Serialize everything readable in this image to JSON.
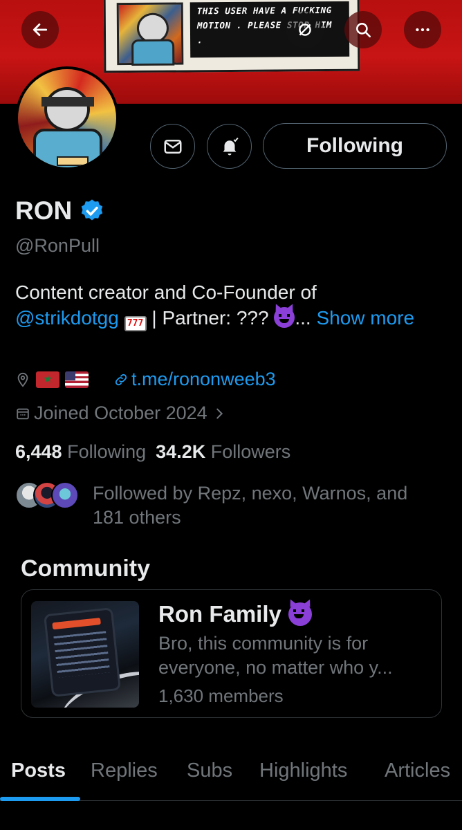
{
  "header": {
    "banner_text": "THIS USER HAVE A FUCKING MOTION . PLEASE STOP HIM .",
    "back_icon": "back-arrow-icon",
    "search_icon": "search-icon",
    "more_icon": "more-icon"
  },
  "profile": {
    "display_name": "RON",
    "handle": "@RonPull",
    "following_label": "Following",
    "bio_text": "Content creator and Co-Founder of",
    "bio_mention": "@strikdotgg",
    "bio_partner": "| Partner: ???",
    "bio_ellipsis": "...",
    "show_more": "Show more",
    "website": "t.me/rononweeb3",
    "joined": "Joined October 2024",
    "following_count": "6,448",
    "following_word": "Following",
    "followers_count": "34.2K",
    "followers_word": "Followers",
    "followed_by": "Followed by Repz, nexo, Warnos, and 181 others"
  },
  "community": {
    "heading": "Community",
    "name": "Ron Family",
    "description": "Bro, this community is for everyone, no matter who y...",
    "members": "1,630 members"
  },
  "tabs": [
    "Posts",
    "Replies",
    "Subs",
    "Highlights",
    "Articles"
  ],
  "colors": {
    "accent": "#1d9bf0",
    "banner": "#c81414",
    "muted_text": "#71767b"
  }
}
